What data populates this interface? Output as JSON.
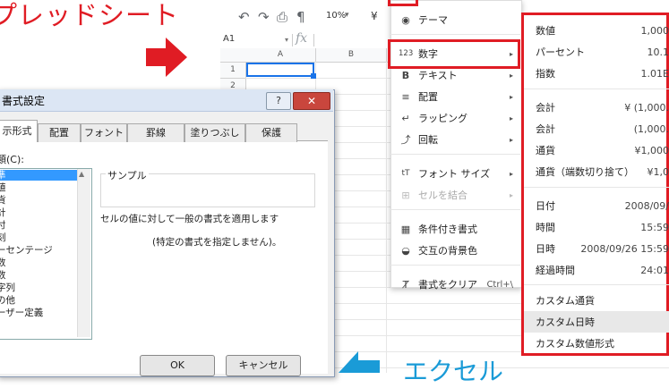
{
  "banner": {
    "text": "プレッドシート",
    "color": "#e01c24"
  },
  "excel_label": {
    "text": "エクセル",
    "color": "#1a9bd7"
  },
  "sheets": {
    "zoom": "10%",
    "currency_symbol": "¥",
    "cell_ref": "A1",
    "fx": "fx",
    "columns": [
      "A",
      "B"
    ],
    "rows": [
      "1",
      "2"
    ]
  },
  "format_menu": {
    "items": [
      {
        "icon": "palette-icon",
        "glyph": "◉",
        "label": "テーマ",
        "arrow": "",
        "shortcut": ""
      },
      {
        "icon": "number-format-icon",
        "glyph": "123",
        "label": "数字",
        "arrow": "▸",
        "shortcut": ""
      },
      {
        "icon": "bold-icon",
        "glyph": "B",
        "label": "テキスト",
        "arrow": "▸",
        "shortcut": ""
      },
      {
        "icon": "align-icon",
        "glyph": "≡",
        "label": "配置",
        "arrow": "▸",
        "shortcut": ""
      },
      {
        "icon": "wrap-icon",
        "glyph": "↵",
        "label": "ラッピング",
        "arrow": "▸",
        "shortcut": ""
      },
      {
        "icon": "rotate-icon",
        "glyph": "⤴",
        "label": "回転",
        "arrow": "▸",
        "shortcut": ""
      },
      {
        "icon": "font-size-icon",
        "glyph": "tT",
        "label": "フォント サイズ",
        "arrow": "▸",
        "shortcut": ""
      },
      {
        "icon": "merge-icon",
        "glyph": "⊞",
        "label": "セルを結合",
        "arrow": "▸",
        "shortcut": ""
      },
      {
        "icon": "conditional-format-icon",
        "glyph": "▦",
        "label": "条件付き書式",
        "arrow": "",
        "shortcut": ""
      },
      {
        "icon": "alternating-colors-icon",
        "glyph": "◒",
        "label": "交互の背景色",
        "arrow": "",
        "shortcut": ""
      },
      {
        "icon": "clear-format-icon",
        "glyph": "Ⱦ",
        "label": "書式をクリア",
        "arrow": "",
        "shortcut": "Ctrl+\\"
      }
    ]
  },
  "number_menu": {
    "items": [
      {
        "label": "数値",
        "value": "1,000"
      },
      {
        "label": "パーセント",
        "value": "10.1"
      },
      {
        "label": "指数",
        "value": "1.01E"
      },
      {
        "label": "会計",
        "value": "¥ (1,000."
      },
      {
        "label": "会計",
        "value": "(1,000."
      },
      {
        "label": "通貨",
        "value": "¥1,000"
      },
      {
        "label": "通貨（端数切り捨て）",
        "value": "¥1,0"
      },
      {
        "label": "日付",
        "value": "2008/09/"
      },
      {
        "label": "時間",
        "value": "15:59"
      },
      {
        "label": "日時",
        "value": "2008/09/26 15:59"
      },
      {
        "label": "経過時間",
        "value": "24:01"
      },
      {
        "label": "カスタム通貨",
        "value": ""
      },
      {
        "label": "カスタム日時",
        "value": ""
      },
      {
        "label": "カスタム数値形式",
        "value": ""
      }
    ]
  },
  "dialog": {
    "title": "書式設定",
    "help": "?",
    "close": "✕",
    "tabs": [
      "示形式",
      "配置",
      "フォント",
      "罫線",
      "塗りつぶし",
      "保護"
    ],
    "category_label": "類(C):",
    "categories": [
      "準",
      "値",
      "貨",
      "計",
      "付",
      "刻",
      "ーセンテージ",
      "数",
      "数",
      "字列",
      "の他",
      "ーザー定義"
    ],
    "sample_label": "サンプル",
    "description": "セルの値に対して一般の書式を適用します",
    "description2": "(特定の書式を指定しません)。",
    "ok": "OK",
    "cancel": "キャンセル"
  }
}
